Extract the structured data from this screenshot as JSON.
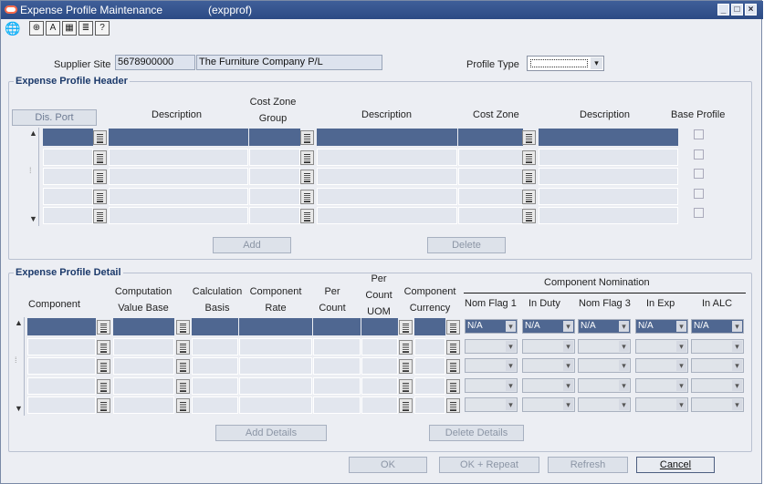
{
  "window": {
    "title": "Expense Profile Maintenance",
    "module": "(expprof)"
  },
  "toolbar": {
    "icons": [
      "globe-icon",
      "help-icon",
      "spell-icon",
      "calculator-icon",
      "print-icon",
      "question-icon"
    ]
  },
  "supplier": {
    "label": "Supplier Site",
    "id": "5678900000",
    "name": "The Furniture Company P/L"
  },
  "profile_type": {
    "label": "Profile Type",
    "value": ""
  },
  "header": {
    "title": "Expense Profile Header",
    "dis_port_label": "Dis. Port",
    "col_description1": "Description",
    "col_cost_zone_group": "Cost Zone Group",
    "col_description2": "Description",
    "col_cost_zone": "Cost Zone",
    "col_description3": "Description",
    "col_base_profile": "Base Profile",
    "add_label": "Add",
    "delete_label": "Delete",
    "row_count": 5
  },
  "detail": {
    "title": "Expense Profile Detail",
    "col_component": "Component",
    "col_computation": "Computation Value Base",
    "col_calculation": "Calculation Basis",
    "col_rate": "Component Rate",
    "col_per_count": "Per Count",
    "col_per_count_uom": "Per Count UOM",
    "col_currency": "Component Currency",
    "nomination_label": "Component Nomination",
    "nom_cols": [
      "Nom Flag 1",
      "In Duty",
      "Nom Flag 3",
      "In Exp",
      "In ALC"
    ],
    "nom_values": [
      "N/A",
      "N/A",
      "N/A",
      "N/A",
      "N/A"
    ],
    "add_details_label": "Add Details",
    "delete_details_label": "Delete Details",
    "row_count": 5
  },
  "buttons": {
    "ok": "OK",
    "ok_repeat": "OK + Repeat",
    "refresh": "Refresh",
    "cancel": "Cancel"
  },
  "colors": {
    "titlebar": "#2c4a84",
    "selected_row": "#4f6791",
    "frame_title": "#1c3a6b"
  }
}
